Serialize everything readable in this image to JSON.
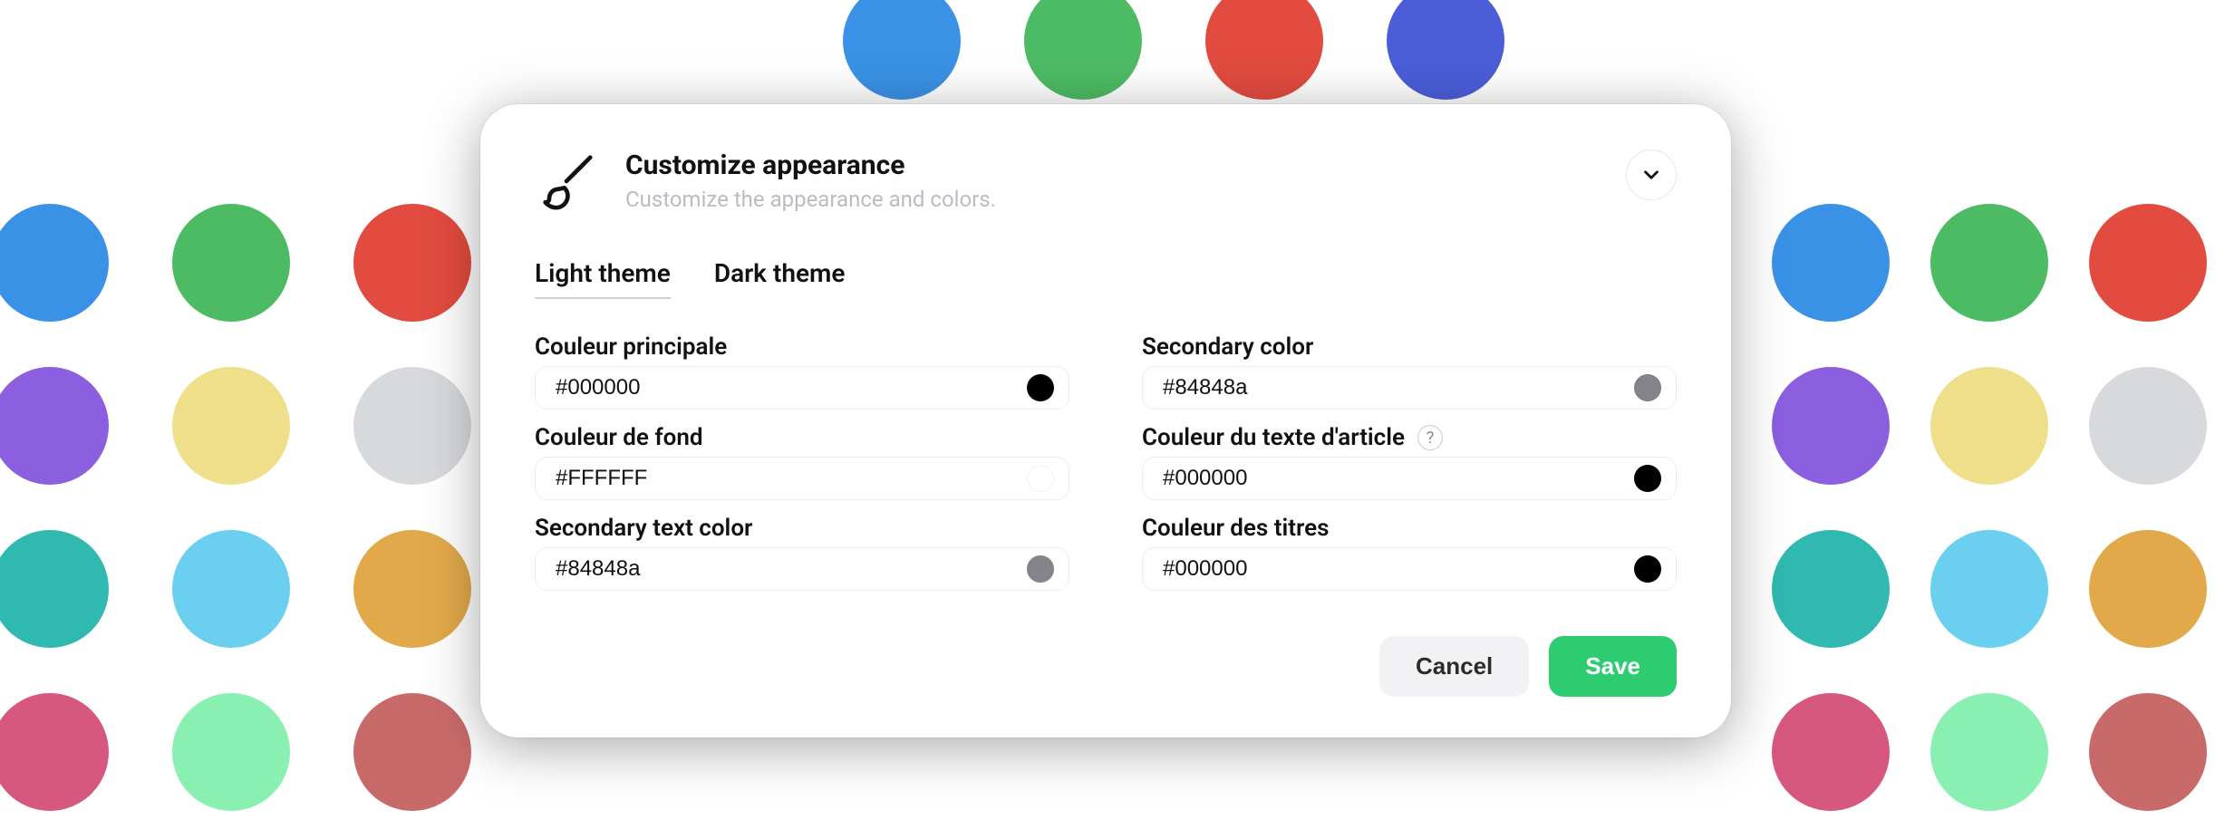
{
  "header": {
    "title": "Customize appearance",
    "subtitle": "Customize the appearance and colors."
  },
  "tabs": {
    "light": "Light theme",
    "dark": "Dark theme"
  },
  "fields": {
    "primary": {
      "label": "Couleur principale",
      "value": "#000000",
      "swatch": "#000000"
    },
    "secondary": {
      "label": "Secondary color",
      "value": "#84848a",
      "swatch": "#84848a"
    },
    "bg": {
      "label": "Couleur de fond",
      "value": "#FFFFFF",
      "swatch": "#ffffff"
    },
    "article": {
      "label": "Couleur du texte d'article",
      "value": "#000000",
      "swatch": "#000000",
      "help": "?"
    },
    "sectext": {
      "label": "Secondary text color",
      "value": "#84848a",
      "swatch": "#84848a"
    },
    "titles": {
      "label": "Couleur des titres",
      "value": "#000000",
      "swatch": "#000000"
    }
  },
  "buttons": {
    "cancel": "Cancel",
    "save": "Save"
  },
  "bg_palette": {
    "top": [
      "#3a92e6",
      "#4dbb64",
      "#e24b3f",
      "#4b5ed8"
    ],
    "row1": [
      "#3a92e6",
      "#4dbb64",
      "#e24b3f",
      "#3a92e6",
      "#4dbb64",
      "#e24b3f",
      "#4b5ed8"
    ],
    "row2": [
      "#8b5fe0",
      "#f0df8a",
      "#d7d9dc",
      "#8b5fe0",
      "#f0df8a",
      "#d7d9dc",
      "#3b3b3e"
    ],
    "row3": [
      "#2fb9b1",
      "#6bd0f0",
      "#e1a94a",
      "#2fb9b1",
      "#6bd0f0",
      "#e1a94a",
      "#2e5aa8"
    ],
    "row4": [
      "#d7587f",
      "#8af0b1",
      "#c96a6a",
      "#d7587f",
      "#8af0b1",
      "#c96a6a",
      "#e1a94a"
    ]
  }
}
